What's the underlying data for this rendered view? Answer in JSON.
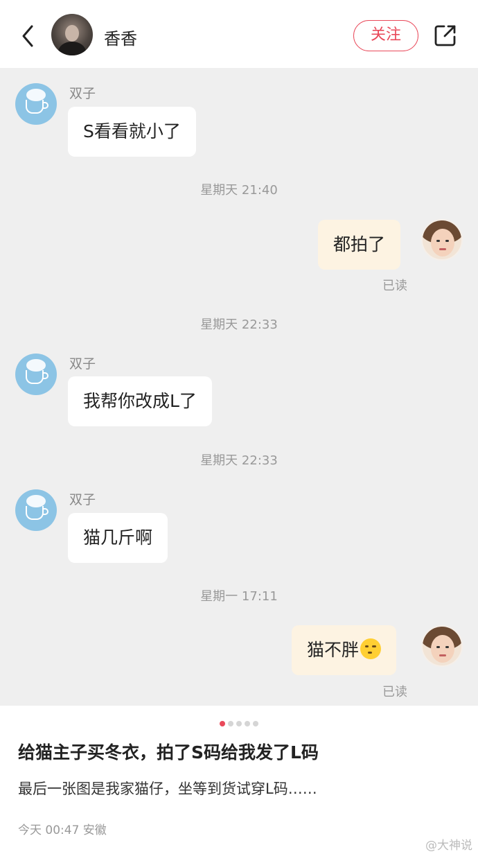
{
  "header": {
    "name": "香香",
    "follow_label": "关注"
  },
  "messages": [
    {
      "type": "left",
      "sender": "双子",
      "text": "S看看就小了"
    },
    {
      "type": "time",
      "text": "星期天 21:40"
    },
    {
      "type": "right",
      "text": "都拍了",
      "status": "已读"
    },
    {
      "type": "time",
      "text": "星期天 22:33"
    },
    {
      "type": "left",
      "sender": "双子",
      "text": "我帮你改成L了"
    },
    {
      "type": "time",
      "text": "星期天 22:33"
    },
    {
      "type": "left",
      "sender": "双子",
      "text": "猫几斤啊"
    },
    {
      "type": "time",
      "text": "星期一 17:11"
    },
    {
      "type": "right",
      "text": "猫不胖",
      "emoji": "thinking-face-emoji",
      "status": "已读"
    }
  ],
  "carousel": {
    "count": 5,
    "active_index": 1
  },
  "post": {
    "title": "给猫主子买冬衣，拍了S码给我发了L码",
    "description": "最后一张图是我家猫仔，坐等到货试穿L码……",
    "meta": "今天 00:47 安徽"
  },
  "watermark": "@大神说"
}
